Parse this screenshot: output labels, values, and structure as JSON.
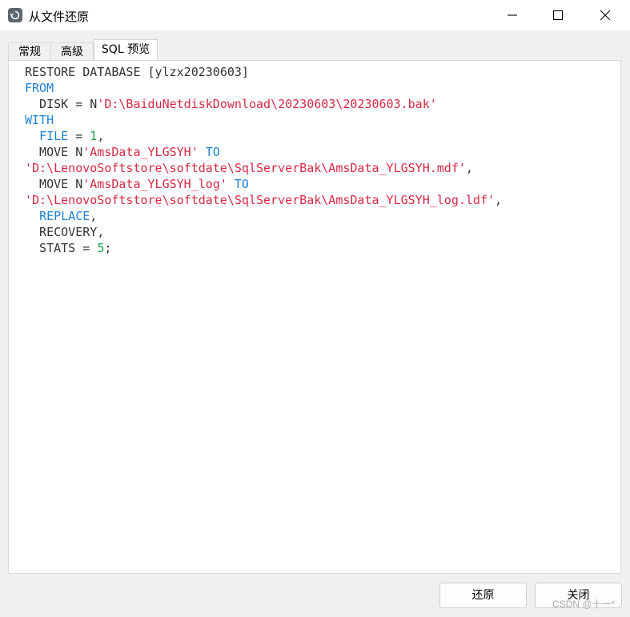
{
  "window": {
    "title": "从文件还原",
    "app_icon": "restore-database-icon",
    "controls": [
      "minimize-icon",
      "maximize-icon",
      "close-icon"
    ]
  },
  "tabs": [
    {
      "label": "常规",
      "active": false
    },
    {
      "label": "高级",
      "active": false
    },
    {
      "label": "SQL 预览",
      "active": true
    }
  ],
  "sql_preview": {
    "lines": [
      [
        {
          "t": "RESTORE DATABASE [ylzx20230603]",
          "c": "plain"
        }
      ],
      [
        {
          "t": "FROM",
          "c": "kw"
        }
      ],
      [
        {
          "t": "  DISK = N",
          "c": "plain"
        },
        {
          "t": "'D:\\BaiduNetdiskDownload\\20230603\\20230603.bak'",
          "c": "str"
        }
      ],
      [
        {
          "t": "WITH",
          "c": "kw"
        }
      ],
      [
        {
          "t": "  ",
          "c": "plain"
        },
        {
          "t": "FILE",
          "c": "kw"
        },
        {
          "t": " = ",
          "c": "plain"
        },
        {
          "t": "1",
          "c": "num"
        },
        {
          "t": ",",
          "c": "plain"
        }
      ],
      [
        {
          "t": "  MOVE N",
          "c": "plain"
        },
        {
          "t": "'AmsData_YLGSYH'",
          "c": "str"
        },
        {
          "t": " ",
          "c": "plain"
        },
        {
          "t": "TO",
          "c": "kw"
        }
      ],
      [
        {
          "t": "'D:\\LenovoSoftstore\\softdate\\SqlServerBak\\AmsData_YLGSYH.mdf'",
          "c": "str"
        },
        {
          "t": ",",
          "c": "plain"
        }
      ],
      [
        {
          "t": "  MOVE N",
          "c": "plain"
        },
        {
          "t": "'AmsData_YLGSYH_log'",
          "c": "str"
        },
        {
          "t": " ",
          "c": "plain"
        },
        {
          "t": "TO",
          "c": "kw"
        }
      ],
      [
        {
          "t": "'D:\\LenovoSoftstore\\softdate\\SqlServerBak\\AmsData_YLGSYH_log.ldf'",
          "c": "str"
        },
        {
          "t": ",",
          "c": "plain"
        }
      ],
      [
        {
          "t": "  ",
          "c": "plain"
        },
        {
          "t": "REPLACE",
          "c": "kw"
        },
        {
          "t": ",",
          "c": "plain"
        }
      ],
      [
        {
          "t": "  RECOVERY,",
          "c": "plain"
        }
      ],
      [
        {
          "t": "  STATS = ",
          "c": "plain"
        },
        {
          "t": "5",
          "c": "num"
        },
        {
          "t": ";",
          "c": "plain"
        }
      ]
    ]
  },
  "buttons": {
    "restore": "还原",
    "close": "关闭"
  },
  "watermark": "CSDN @十一*",
  "colors": {
    "keyword": "#1c7fd6",
    "string": "#d62a48",
    "number": "#17a34a",
    "plain": "#333333"
  }
}
